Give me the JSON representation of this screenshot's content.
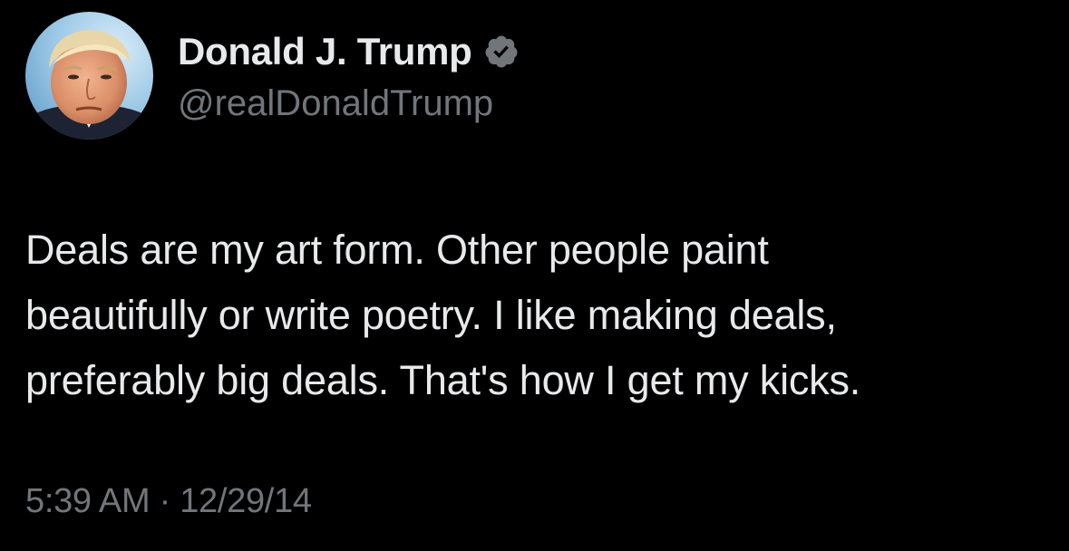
{
  "author": {
    "name": "Donald J. Trump",
    "handle": "@realDonaldTrump",
    "verified_icon": "verified-badge-icon",
    "verified_color": "#71767b",
    "avatar_icon": "profile-photo"
  },
  "tweet": {
    "lines": [
      "Deals are my art form. Other people paint",
      "beautifully or write poetry. I like making deals,",
      "preferably big deals. That's how I get my kicks."
    ]
  },
  "meta": {
    "time": "5:39 AM",
    "separator": "·",
    "date": "12/29/14"
  },
  "colors": {
    "background": "#000000",
    "primary_text": "#e7e9ea",
    "secondary_text": "#71767b"
  }
}
